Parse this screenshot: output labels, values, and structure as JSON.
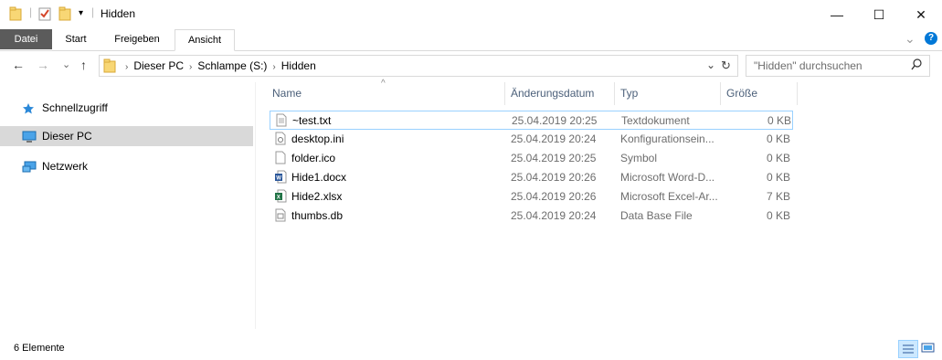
{
  "window": {
    "title": "Hidden",
    "minimize_glyph": "—",
    "maximize_glyph": "☐",
    "close_glyph": "✕"
  },
  "ribbon": {
    "tabs": [
      "Datei",
      "Start",
      "Freigeben",
      "Ansicht"
    ],
    "collapse_glyph": "⌄",
    "help_glyph": "?"
  },
  "nav": {
    "back_glyph": "←",
    "forward_glyph": "→",
    "recent_glyph": "⌄",
    "up_glyph": "↑",
    "breadcrumb": [
      "Dieser PC",
      "Schlampe (S:)",
      "Hidden"
    ],
    "dropdown_glyph": "⌄",
    "refresh_glyph": "↻",
    "search_placeholder": "\"Hidden\" durchsuchen"
  },
  "sidebar": {
    "items": [
      {
        "label": "Schnellzugriff",
        "icon": "star-icon"
      },
      {
        "label": "Dieser PC",
        "icon": "computer-icon"
      },
      {
        "label": "Netzwerk",
        "icon": "network-icon"
      }
    ]
  },
  "file_list": {
    "columns": [
      "Name",
      "Änderungsdatum",
      "Typ",
      "Größe"
    ],
    "sort_glyph": "^",
    "rows": [
      {
        "name": "~test.txt",
        "date": "25.04.2019 20:25",
        "type": "Textdokument",
        "size": "0 KB",
        "icon": "text-file-icon"
      },
      {
        "name": "desktop.ini",
        "date": "25.04.2019 20:24",
        "type": "Konfigurationsein...",
        "size": "0 KB",
        "icon": "settings-file-icon"
      },
      {
        "name": "folder.ico",
        "date": "25.04.2019 20:25",
        "type": "Symbol",
        "size": "0 KB",
        "icon": "blank-file-icon"
      },
      {
        "name": "Hide1.docx",
        "date": "25.04.2019 20:26",
        "type": "Microsoft Word-D...",
        "size": "0 KB",
        "icon": "word-file-icon"
      },
      {
        "name": "Hide2.xlsx",
        "date": "25.04.2019 20:26",
        "type": "Microsoft Excel-Ar...",
        "size": "7 KB",
        "icon": "excel-file-icon"
      },
      {
        "name": "thumbs.db",
        "date": "25.04.2019 20:24",
        "type": "Data Base File",
        "size": "0 KB",
        "icon": "db-file-icon"
      }
    ]
  },
  "status": {
    "item_count": "6 Elemente"
  },
  "colors": {
    "accent": "#0078d7",
    "file_tab": "#5b5b5b",
    "selection": "#d9d9d9",
    "focus_border": "#99d1ff",
    "header_text": "#4c607a"
  }
}
